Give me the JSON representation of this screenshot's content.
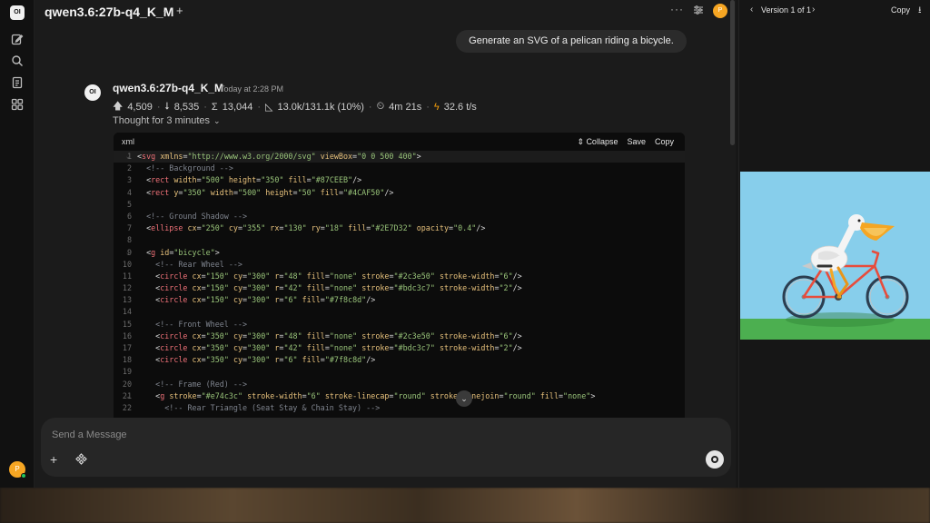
{
  "rail": {
    "logo": "OI",
    "avatar_letter": "P"
  },
  "topbar": {
    "model_title": "qwen3.6:27b-q4_K_M",
    "dots": "···",
    "avatar_letter": "P"
  },
  "user_message": "Generate an SVG of a pelican riding a bicycle.",
  "assistant": {
    "avatar": "OI",
    "name": "qwen3.6:27b-q4_K_M",
    "time": "Today at 2:28 PM",
    "stats": {
      "prompt_tokens": "4,509",
      "completion_tokens": "8,535",
      "total_tokens": "13,044",
      "context": "13.0k/131.1k (10%)",
      "duration": "4m 21s",
      "speed": "32.6 t/s"
    },
    "thought": "Thought for 3 minutes"
  },
  "code_block": {
    "language": "xml",
    "collapse_label": "Collapse",
    "save_label": "Save",
    "copy_label": "Copy",
    "lines": [
      {
        "n": "1",
        "segs": [
          [
            "p",
            "<"
          ],
          [
            "t",
            "svg"
          ],
          [
            "p",
            " "
          ],
          [
            "a",
            "xmlns"
          ],
          [
            "p",
            "="
          ],
          [
            "s",
            "\"http://www.w3.org/2000/svg\""
          ],
          [
            "p",
            " "
          ],
          [
            "a",
            "viewBox"
          ],
          [
            "p",
            "="
          ],
          [
            "s",
            "\"0 0 500 400\""
          ],
          [
            "p",
            ">"
          ]
        ]
      },
      {
        "n": "2",
        "segs": [
          [
            "c",
            "  <!-- Background -->"
          ]
        ]
      },
      {
        "n": "3",
        "segs": [
          [
            "p",
            "  <"
          ],
          [
            "t",
            "rect"
          ],
          [
            "p",
            " "
          ],
          [
            "a",
            "width"
          ],
          [
            "p",
            "="
          ],
          [
            "s",
            "\"500\""
          ],
          [
            "p",
            " "
          ],
          [
            "a",
            "height"
          ],
          [
            "p",
            "="
          ],
          [
            "s",
            "\"350\""
          ],
          [
            "p",
            " "
          ],
          [
            "a",
            "fill"
          ],
          [
            "p",
            "="
          ],
          [
            "s",
            "\"#87CEEB\""
          ],
          [
            "p",
            "/>"
          ]
        ]
      },
      {
        "n": "4",
        "segs": [
          [
            "p",
            "  <"
          ],
          [
            "t",
            "rect"
          ],
          [
            "p",
            " "
          ],
          [
            "a",
            "y"
          ],
          [
            "p",
            "="
          ],
          [
            "s",
            "\"350\""
          ],
          [
            "p",
            " "
          ],
          [
            "a",
            "width"
          ],
          [
            "p",
            "="
          ],
          [
            "s",
            "\"500\""
          ],
          [
            "p",
            " "
          ],
          [
            "a",
            "height"
          ],
          [
            "p",
            "="
          ],
          [
            "s",
            "\"50\""
          ],
          [
            "p",
            " "
          ],
          [
            "a",
            "fill"
          ],
          [
            "p",
            "="
          ],
          [
            "s",
            "\"#4CAF50\""
          ],
          [
            "p",
            "/>"
          ]
        ]
      },
      {
        "n": "5",
        "segs": []
      },
      {
        "n": "6",
        "segs": [
          [
            "c",
            "  <!-- Ground Shadow -->"
          ]
        ]
      },
      {
        "n": "7",
        "segs": [
          [
            "p",
            "  <"
          ],
          [
            "t",
            "ellipse"
          ],
          [
            "p",
            " "
          ],
          [
            "a",
            "cx"
          ],
          [
            "p",
            "="
          ],
          [
            "s",
            "\"250\""
          ],
          [
            "p",
            " "
          ],
          [
            "a",
            "cy"
          ],
          [
            "p",
            "="
          ],
          [
            "s",
            "\"355\""
          ],
          [
            "p",
            " "
          ],
          [
            "a",
            "rx"
          ],
          [
            "p",
            "="
          ],
          [
            "s",
            "\"130\""
          ],
          [
            "p",
            " "
          ],
          [
            "a",
            "ry"
          ],
          [
            "p",
            "="
          ],
          [
            "s",
            "\"18\""
          ],
          [
            "p",
            " "
          ],
          [
            "a",
            "fill"
          ],
          [
            "p",
            "="
          ],
          [
            "s",
            "\"#2E7D32\""
          ],
          [
            "p",
            " "
          ],
          [
            "a",
            "opacity"
          ],
          [
            "p",
            "="
          ],
          [
            "s",
            "\"0.4\""
          ],
          [
            "p",
            "/>"
          ]
        ]
      },
      {
        "n": "8",
        "segs": []
      },
      {
        "n": "9",
        "segs": [
          [
            "p",
            "  <"
          ],
          [
            "t",
            "g"
          ],
          [
            "p",
            " "
          ],
          [
            "a",
            "id"
          ],
          [
            "p",
            "="
          ],
          [
            "s",
            "\"bicycle\""
          ],
          [
            "p",
            ">"
          ]
        ]
      },
      {
        "n": "10",
        "segs": [
          [
            "c",
            "    <!-- Rear Wheel -->"
          ]
        ]
      },
      {
        "n": "11",
        "segs": [
          [
            "p",
            "    <"
          ],
          [
            "t",
            "circle"
          ],
          [
            "p",
            " "
          ],
          [
            "a",
            "cx"
          ],
          [
            "p",
            "="
          ],
          [
            "s",
            "\"150\""
          ],
          [
            "p",
            " "
          ],
          [
            "a",
            "cy"
          ],
          [
            "p",
            "="
          ],
          [
            "s",
            "\"300\""
          ],
          [
            "p",
            " "
          ],
          [
            "a",
            "r"
          ],
          [
            "p",
            "="
          ],
          [
            "s",
            "\"48\""
          ],
          [
            "p",
            " "
          ],
          [
            "a",
            "fill"
          ],
          [
            "p",
            "="
          ],
          [
            "s",
            "\"none\""
          ],
          [
            "p",
            " "
          ],
          [
            "a",
            "stroke"
          ],
          [
            "p",
            "="
          ],
          [
            "s",
            "\"#2c3e50\""
          ],
          [
            "p",
            " "
          ],
          [
            "a",
            "stroke-width"
          ],
          [
            "p",
            "="
          ],
          [
            "s",
            "\"6\""
          ],
          [
            "p",
            "/>"
          ]
        ]
      },
      {
        "n": "12",
        "segs": [
          [
            "p",
            "    <"
          ],
          [
            "t",
            "circle"
          ],
          [
            "p",
            " "
          ],
          [
            "a",
            "cx"
          ],
          [
            "p",
            "="
          ],
          [
            "s",
            "\"150\""
          ],
          [
            "p",
            " "
          ],
          [
            "a",
            "cy"
          ],
          [
            "p",
            "="
          ],
          [
            "s",
            "\"300\""
          ],
          [
            "p",
            " "
          ],
          [
            "a",
            "r"
          ],
          [
            "p",
            "="
          ],
          [
            "s",
            "\"42\""
          ],
          [
            "p",
            " "
          ],
          [
            "a",
            "fill"
          ],
          [
            "p",
            "="
          ],
          [
            "s",
            "\"none\""
          ],
          [
            "p",
            " "
          ],
          [
            "a",
            "stroke"
          ],
          [
            "p",
            "="
          ],
          [
            "s",
            "\"#bdc3c7\""
          ],
          [
            "p",
            " "
          ],
          [
            "a",
            "stroke-width"
          ],
          [
            "p",
            "="
          ],
          [
            "s",
            "\"2\""
          ],
          [
            "p",
            "/>"
          ]
        ]
      },
      {
        "n": "13",
        "segs": [
          [
            "p",
            "    <"
          ],
          [
            "t",
            "circle"
          ],
          [
            "p",
            " "
          ],
          [
            "a",
            "cx"
          ],
          [
            "p",
            "="
          ],
          [
            "s",
            "\"150\""
          ],
          [
            "p",
            " "
          ],
          [
            "a",
            "cy"
          ],
          [
            "p",
            "="
          ],
          [
            "s",
            "\"300\""
          ],
          [
            "p",
            " "
          ],
          [
            "a",
            "r"
          ],
          [
            "p",
            "="
          ],
          [
            "s",
            "\"6\""
          ],
          [
            "p",
            " "
          ],
          [
            "a",
            "fill"
          ],
          [
            "p",
            "="
          ],
          [
            "s",
            "\"#7f8c8d\""
          ],
          [
            "p",
            "/>"
          ]
        ]
      },
      {
        "n": "14",
        "segs": []
      },
      {
        "n": "15",
        "segs": [
          [
            "c",
            "    <!-- Front Wheel -->"
          ]
        ]
      },
      {
        "n": "16",
        "segs": [
          [
            "p",
            "    <"
          ],
          [
            "t",
            "circle"
          ],
          [
            "p",
            " "
          ],
          [
            "a",
            "cx"
          ],
          [
            "p",
            "="
          ],
          [
            "s",
            "\"350\""
          ],
          [
            "p",
            " "
          ],
          [
            "a",
            "cy"
          ],
          [
            "p",
            "="
          ],
          [
            "s",
            "\"300\""
          ],
          [
            "p",
            " "
          ],
          [
            "a",
            "r"
          ],
          [
            "p",
            "="
          ],
          [
            "s",
            "\"48\""
          ],
          [
            "p",
            " "
          ],
          [
            "a",
            "fill"
          ],
          [
            "p",
            "="
          ],
          [
            "s",
            "\"none\""
          ],
          [
            "p",
            " "
          ],
          [
            "a",
            "stroke"
          ],
          [
            "p",
            "="
          ],
          [
            "s",
            "\"#2c3e50\""
          ],
          [
            "p",
            " "
          ],
          [
            "a",
            "stroke-width"
          ],
          [
            "p",
            "="
          ],
          [
            "s",
            "\"6\""
          ],
          [
            "p",
            "/>"
          ]
        ]
      },
      {
        "n": "17",
        "segs": [
          [
            "p",
            "    <"
          ],
          [
            "t",
            "circle"
          ],
          [
            "p",
            " "
          ],
          [
            "a",
            "cx"
          ],
          [
            "p",
            "="
          ],
          [
            "s",
            "\"350\""
          ],
          [
            "p",
            " "
          ],
          [
            "a",
            "cy"
          ],
          [
            "p",
            "="
          ],
          [
            "s",
            "\"300\""
          ],
          [
            "p",
            " "
          ],
          [
            "a",
            "r"
          ],
          [
            "p",
            "="
          ],
          [
            "s",
            "\"42\""
          ],
          [
            "p",
            " "
          ],
          [
            "a",
            "fill"
          ],
          [
            "p",
            "="
          ],
          [
            "s",
            "\"none\""
          ],
          [
            "p",
            " "
          ],
          [
            "a",
            "stroke"
          ],
          [
            "p",
            "="
          ],
          [
            "s",
            "\"#bdc3c7\""
          ],
          [
            "p",
            " "
          ],
          [
            "a",
            "stroke-width"
          ],
          [
            "p",
            "="
          ],
          [
            "s",
            "\"2\""
          ],
          [
            "p",
            "/>"
          ]
        ]
      },
      {
        "n": "18",
        "segs": [
          [
            "p",
            "    <"
          ],
          [
            "t",
            "circle"
          ],
          [
            "p",
            " "
          ],
          [
            "a",
            "cx"
          ],
          [
            "p",
            "="
          ],
          [
            "s",
            "\"350\""
          ],
          [
            "p",
            " "
          ],
          [
            "a",
            "cy"
          ],
          [
            "p",
            "="
          ],
          [
            "s",
            "\"300\""
          ],
          [
            "p",
            " "
          ],
          [
            "a",
            "r"
          ],
          [
            "p",
            "="
          ],
          [
            "s",
            "\"6\""
          ],
          [
            "p",
            " "
          ],
          [
            "a",
            "fill"
          ],
          [
            "p",
            "="
          ],
          [
            "s",
            "\"#7f8c8d\""
          ],
          [
            "p",
            "/>"
          ]
        ]
      },
      {
        "n": "19",
        "segs": []
      },
      {
        "n": "20",
        "segs": [
          [
            "c",
            "    <!-- Frame (Red) -->"
          ]
        ]
      },
      {
        "n": "21",
        "segs": [
          [
            "p",
            "    <"
          ],
          [
            "t",
            "g"
          ],
          [
            "p",
            " "
          ],
          [
            "a",
            "stroke"
          ],
          [
            "p",
            "="
          ],
          [
            "s",
            "\"#e74c3c\""
          ],
          [
            "p",
            " "
          ],
          [
            "a",
            "stroke-width"
          ],
          [
            "p",
            "="
          ],
          [
            "s",
            "\"6\""
          ],
          [
            "p",
            " "
          ],
          [
            "a",
            "stroke-linecap"
          ],
          [
            "p",
            "="
          ],
          [
            "s",
            "\"round\""
          ],
          [
            "p",
            " "
          ],
          [
            "a",
            "stroke-linejoin"
          ],
          [
            "p",
            "="
          ],
          [
            "s",
            "\"round\""
          ],
          [
            "p",
            " "
          ],
          [
            "a",
            "fill"
          ],
          [
            "p",
            "="
          ],
          [
            "s",
            "\"none\""
          ],
          [
            "p",
            ">"
          ]
        ]
      },
      {
        "n": "22",
        "segs": [
          [
            "c",
            "      <!-- Rear Triangle (Seat Stay & Chain Stay) -->"
          ]
        ]
      }
    ]
  },
  "input": {
    "placeholder": "Send a Message",
    "add_label": "+"
  },
  "artifacts": {
    "version_label": "Version 1 of 1",
    "copy_label": "Copy"
  },
  "icons": {
    "new_chat": "pencil-square-icon",
    "search": "search-icon",
    "notes": "notes-icon",
    "workspace": "grid-icon",
    "tokens_up": "arrow-up-icon",
    "tokens_down": "arrow-down-icon",
    "total": "sigma-icon",
    "context": "ruler-icon",
    "timer": "timer-icon",
    "speed": "bolt-icon"
  },
  "colors": {
    "accent_avatar": "#f6a623",
    "sky": "#87CEEB",
    "grass": "#4CAF50",
    "shadow": "#2E7D32",
    "tire": "#2c3e50",
    "rim": "#bdc3c7",
    "hub": "#7f8c8d",
    "frame": "#e74c3c"
  }
}
